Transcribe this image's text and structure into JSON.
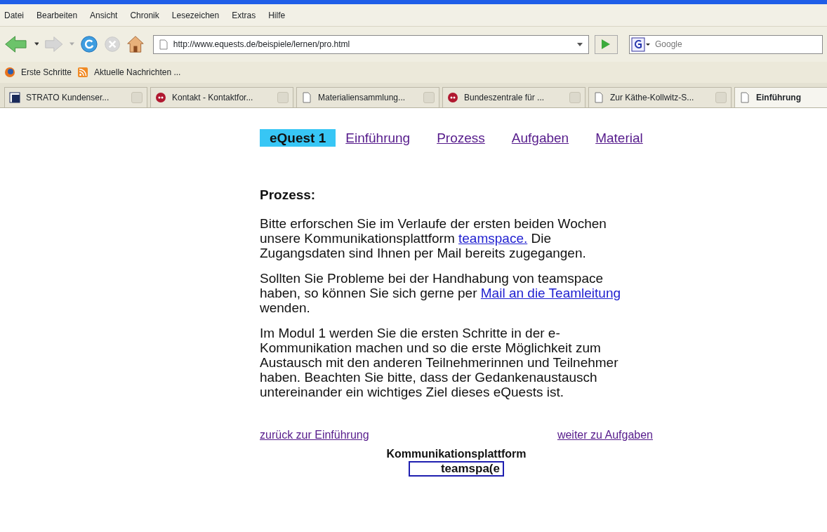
{
  "menu": [
    "Datei",
    "Bearbeiten",
    "Ansicht",
    "Chronik",
    "Lesezeichen",
    "Extras",
    "Hilfe"
  ],
  "address": {
    "url": "http://www.equests.de/beispiele/lernen/pro.html"
  },
  "search": {
    "placeholder": "Google"
  },
  "bookmarks": [
    {
      "label": "Erste Schritte",
      "kind": "firefox"
    },
    {
      "label": "Aktuelle Nachrichten ...",
      "kind": "feed"
    }
  ],
  "tabs": [
    {
      "label": "STRATO Kundenser...",
      "kind": "strato",
      "selected": false
    },
    {
      "label": "Kontakt - Kontaktfor...",
      "kind": "red",
      "selected": false
    },
    {
      "label": "Materialiensammlung...",
      "kind": "page",
      "selected": false
    },
    {
      "label": "Bundeszentrale für ...",
      "kind": "red",
      "selected": false
    },
    {
      "label": "Zur Käthe-Kollwitz-S...",
      "kind": "page",
      "selected": false
    },
    {
      "label": "Einführung",
      "kind": "page",
      "selected": true
    }
  ],
  "page_nav": [
    {
      "label": "eQuest 1",
      "selected": true
    },
    {
      "label": "Einführung",
      "selected": false
    },
    {
      "label": "Prozess",
      "selected": false
    },
    {
      "label": "Aufgaben",
      "selected": false
    },
    {
      "label": "Material",
      "selected": false
    }
  ],
  "heading": "Prozess:",
  "paragraphs": [
    [
      {
        "text": "Bitte erforschen Sie im Verlaufe der ersten beiden Wochen unsere Kommunikationsplattform "
      },
      {
        "link": "teamspace.",
        "visited": false
      },
      {
        "text": " Die Zugangsdaten sind Ihnen per Mail bereits zugegangen."
      }
    ],
    [
      {
        "text": "Sollten Sie Probleme bei der Handhabung von teamspace haben, so können Sie sich gerne per "
      },
      {
        "link": "Mail an die Teamleitung",
        "visited": false
      },
      {
        "text": " wenden."
      }
    ],
    [
      {
        "text": "Im Modul 1 werden Sie die ersten Schritte in der e-Kommunikation machen und so die erste Möglichkeit zum Austausch mit den anderen Teilnehmerinnen und Teilnehmer haben.  Beachten Sie bitte, dass der Gedankenaustausch untereinander ein wichtiges Ziel dieses eQuests ist."
      }
    ]
  ],
  "back_link": {
    "label": "zurück zur Einführung",
    "visited": true
  },
  "next_link": {
    "label": "weiter zu Aufgaben",
    "visited": true
  },
  "footer_title": "Kommunikationsplattform",
  "logo": "teamspa(e"
}
